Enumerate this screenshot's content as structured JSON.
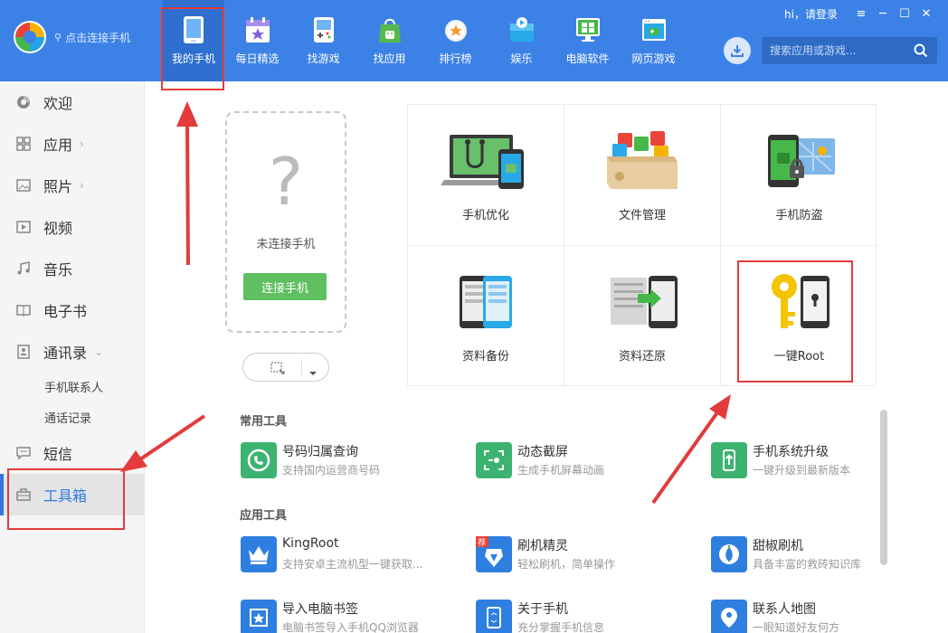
{
  "header": {
    "connect_label": "点击连接手机",
    "login_text": "hi，请登录",
    "search_placeholder": "搜索应用或游戏...",
    "nav": [
      {
        "label": "我的手机",
        "icon": "phone-icon",
        "active": true
      },
      {
        "label": "每日精选",
        "icon": "calendar-star-icon"
      },
      {
        "label": "找游戏",
        "icon": "gamepad-icon"
      },
      {
        "label": "找应用",
        "icon": "android-bag-icon"
      },
      {
        "label": "排行榜",
        "icon": "medal-icon"
      },
      {
        "label": "娱乐",
        "icon": "entertainment-icon"
      },
      {
        "label": "电脑软件",
        "icon": "computer-icon"
      },
      {
        "label": "网页游戏",
        "icon": "web-game-icon"
      }
    ]
  },
  "sidebar": {
    "items": [
      {
        "label": "欢迎",
        "icon": "welcome-icon"
      },
      {
        "label": "应用",
        "icon": "apps-grid-icon",
        "chevron": "›"
      },
      {
        "label": "照片",
        "icon": "photo-icon",
        "chevron": "›"
      },
      {
        "label": "视频",
        "icon": "video-icon"
      },
      {
        "label": "音乐",
        "icon": "music-icon"
      },
      {
        "label": "电子书",
        "icon": "ebook-icon"
      },
      {
        "label": "通讯录",
        "icon": "contacts-icon",
        "chevron": "⌄"
      },
      {
        "label": "短信",
        "icon": "sms-icon"
      },
      {
        "label": "工具箱",
        "icon": "toolbox-icon",
        "active": true
      }
    ],
    "subitems": [
      "手机联系人",
      "通话记录"
    ]
  },
  "phone_panel": {
    "question_mark": "?",
    "status": "未连接手机",
    "connect_button": "连接手机"
  },
  "features": [
    {
      "label": "手机优化",
      "icon": "phone-optimize-icon"
    },
    {
      "label": "文件管理",
      "icon": "file-manager-icon"
    },
    {
      "label": "手机防盗",
      "icon": "anti-theft-icon"
    },
    {
      "label": "资料备份",
      "icon": "backup-icon"
    },
    {
      "label": "资料还原",
      "icon": "restore-icon"
    },
    {
      "label": "一键Root",
      "icon": "root-key-icon"
    }
  ],
  "sections": {
    "common_tools": "常用工具",
    "app_tools": "应用工具"
  },
  "common_tools": [
    {
      "name": "号码归属查询",
      "desc": "支持国内运营商号码",
      "color": "#3cb371"
    },
    {
      "name": "动态截屏",
      "desc": "生成手机屏幕动画",
      "color": "#3cb371"
    },
    {
      "name": "手机系统升级",
      "desc": "一键升级到最新版本",
      "color": "#3cb371"
    }
  ],
  "app_tools": [
    {
      "name": "KingRoot",
      "desc": "支持安卓主流机型一键获取...",
      "color": "#2e7fe0"
    },
    {
      "name": "刷机精灵",
      "desc": "轻松刷机，简单操作",
      "color": "#2e7fe0"
    },
    {
      "name": "甜椒刷机",
      "desc": "具备丰富的救砖知识库",
      "color": "#2e7fe0"
    },
    {
      "name": "导入电脑书签",
      "desc": "电脑书签导入手机QQ浏览器",
      "color": "#2e7fe0"
    },
    {
      "name": "关于手机",
      "desc": "充分掌握手机信息",
      "color": "#2e7fe0"
    },
    {
      "name": "联系人地图",
      "desc": "一眼知道好友何方",
      "color": "#2e7fe0"
    }
  ],
  "colors": {
    "header_bg": "#3c82e6",
    "active_nav": "#2f6fcf",
    "accent": "#2f78e0",
    "connect_btn": "#5fbf61",
    "annotation": "#e33b3b"
  }
}
